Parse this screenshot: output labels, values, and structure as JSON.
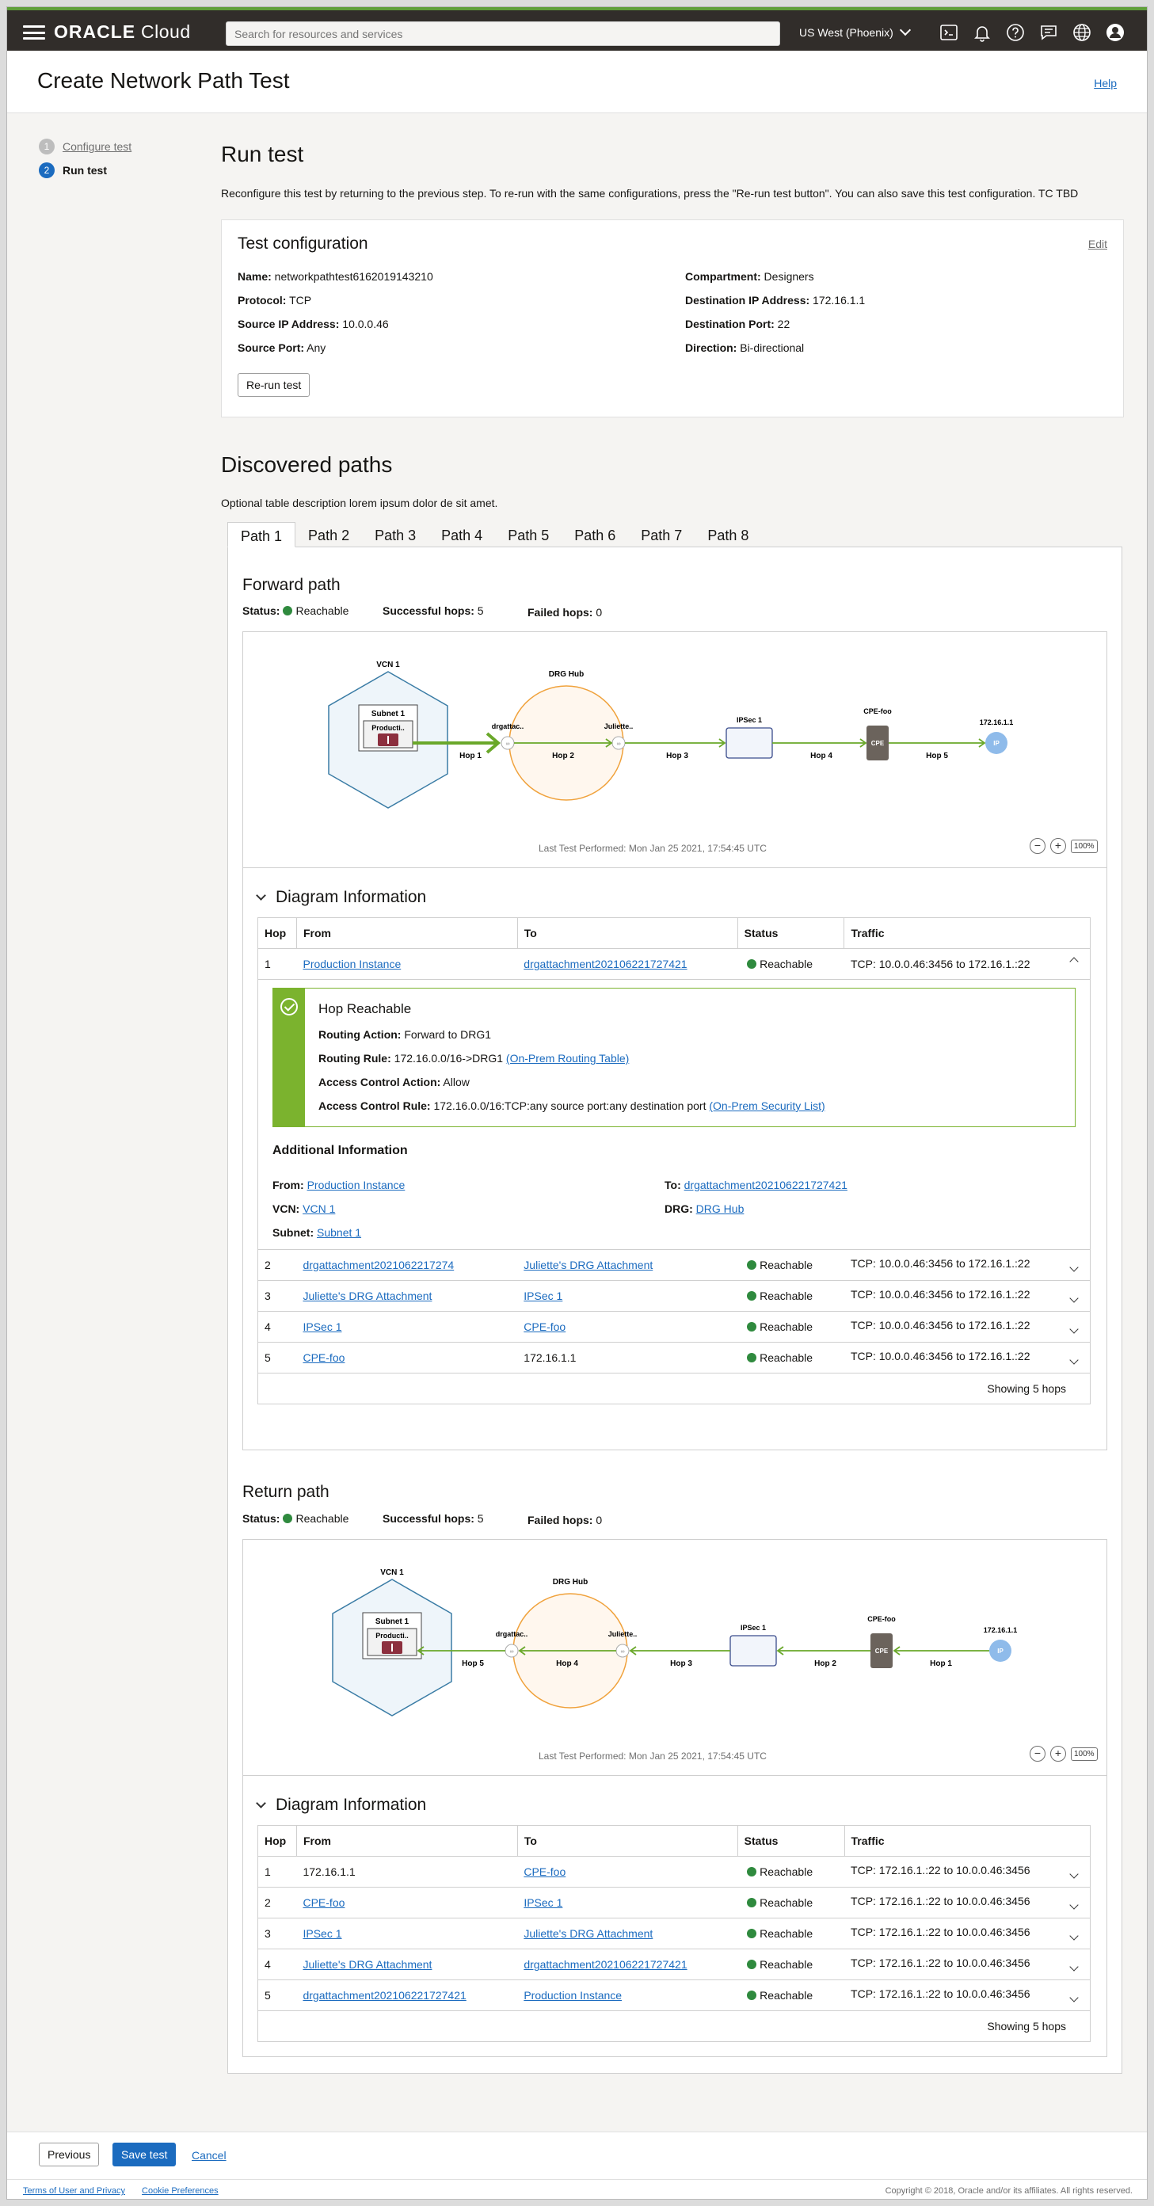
{
  "topbar": {
    "brand_bold": "ORACLE",
    "brand_light": " Cloud",
    "search_placeholder": "Search for resources and services",
    "region": "US West (Phoenix)"
  },
  "header": {
    "title": "Create Network Path Test",
    "help": "Help"
  },
  "steps": [
    {
      "num": "1",
      "label": "Configure test"
    },
    {
      "num": "2",
      "label": "Run test"
    }
  ],
  "run": {
    "title": "Run test",
    "description": "Reconfigure this test by returning to the previous step. To re-run with the same configurations, press the \"Re-run test button\". You can also save this test configuration. TC TBD"
  },
  "config": {
    "title": "Test configuration",
    "edit": "Edit",
    "left": [
      {
        "k": "Name:",
        "v": " networkpathtest6162019143210"
      },
      {
        "k": "Protocol:",
        "v": " TCP"
      },
      {
        "k": "Source IP Address:",
        "v": " 10.0.0.46"
      },
      {
        "k": "Source Port:",
        "v": " Any"
      }
    ],
    "right": [
      {
        "k": "Compartment:",
        "v": " Designers"
      },
      {
        "k": "Destination IP Address:",
        "v": " 172.16.1.1"
      },
      {
        "k": "Destination Port:",
        "v": " 22"
      },
      {
        "k": "Direction:",
        "v": " Bi-directional"
      }
    ],
    "rerun": "Re-run test"
  },
  "discovered": {
    "title": "Discovered paths",
    "description": "Optional table description lorem ipsum dolor de sit amet.",
    "tabs": [
      "Path 1",
      "Path 2",
      "Path 3",
      "Path 4",
      "Path 5",
      "Path 6",
      "Path 7",
      "Path 8"
    ]
  },
  "labels": {
    "status": "Status:",
    "reachable": "Reachable",
    "successful_hops": "Successful hops:",
    "failed_hops": "Failed hops:",
    "diagram_info": "Diagram Information",
    "last_test": "Last Test Performed: Mon Jan 25 2021, 17:54:45 UTC",
    "zoom": "100%",
    "showing": "Showing 5 hops",
    "col_hop": "Hop",
    "col_from": "From",
    "col_to": "To",
    "col_status": "Status",
    "col_traffic": "Traffic"
  },
  "diagram_labels": {
    "vcn": "VCN 1",
    "subnet": "Subnet 1",
    "instance": "Producti..",
    "drg_hub": "DRG Hub",
    "drg_attach": "drgattac..",
    "juliette": "Juliette..",
    "ipsec": "IPSec 1",
    "cpe_foo": "CPE-foo",
    "cpe": "CPE",
    "ip_addr": "172.16.1.1",
    "ip": "IP"
  },
  "forward": {
    "title": "Forward path",
    "successful": " 5",
    "failed": " 0",
    "hop_labels": [
      "Hop 1",
      "Hop 2",
      "Hop 3",
      "Hop 4",
      "Hop 5"
    ],
    "rows": [
      {
        "hop": "1",
        "from": "Production Instance",
        "to": "drgattachment20210622172742​1",
        "status": "Reachable",
        "traffic": "TCP: 10.0.0.46:3456 to 172.16.1.:22"
      },
      {
        "hop": "2",
        "from": "drgattachment2021062217274",
        "to": "Juliette's DRG Attachment ",
        "status": "Reachable",
        "traffic": "TCP: 10.0.0.46:3456 to 172.16.1.:22"
      },
      {
        "hop": "3",
        "from": "Juliette's DRG Attachment ",
        "to": "IPSec 1",
        "status": "Reachable",
        "traffic": "TCP: 10.0.0.46:3456 to 172.16.1.:22"
      },
      {
        "hop": "4",
        "from": "IPSec 1",
        "to": "CPE-foo",
        "status": "Reachable",
        "traffic": "TCP: 10.0.0.46:3456 to 172.16.1.:22"
      },
      {
        "hop": "5",
        "from": "CPE-foo",
        "to": "172.16.1.1",
        "status": "Reachable",
        "traffic": "TCP: 10.0.0.46:3456 to 172.16.1.:22"
      }
    ],
    "detail": {
      "title": "Hop Reachable",
      "routing_action_k": "Routing Action:",
      "routing_action_v": " Forward to DRG1",
      "routing_rule_k": "Routing Rule:",
      "routing_rule_v": " 172.16.0.0/16->DRG1 ",
      "routing_rule_link": "(On-Prem Routing Table)",
      "ac_action_k": "Access Control Action:",
      "ac_action_v": " Allow",
      "ac_rule_k": "Access Control Rule:",
      "ac_rule_v": " 172.16.0.0/16:TCP:any source port:any destination port ",
      "ac_rule_link": "(On-Prem Security List)",
      "addl_title": "Additional Information",
      "from_k": "From:",
      "from_v": "Production Instance",
      "to_k": "To:",
      "to_v": "drgattachment202106221727421",
      "vcn_k": "VCN:",
      "vcn_v": "VCN 1",
      "drg_k": "DRG:",
      "drg_v": "DRG Hub",
      "subnet_k": "Subnet:",
      "subnet_v": "Subnet 1"
    }
  },
  "return": {
    "title": "Return path",
    "successful": " 5",
    "failed": " 0",
    "hop_labels": [
      "Hop 5",
      "Hop 4",
      "Hop 3",
      "Hop 2",
      "Hop 1"
    ],
    "rows": [
      {
        "hop": "1",
        "from": "172.16.1.1",
        "to": "CPE-foo",
        "status": "Reachable",
        "traffic": "TCP: 172.16.1.:22 to 10.0.0.46:3456"
      },
      {
        "hop": "2",
        "from": "CPE-foo",
        "to": "IPSec 1",
        "status": "Reachable",
        "traffic": "TCP: 172.16.1.:22 to 10.0.0.46:3456"
      },
      {
        "hop": "3",
        "from": "IPSec 1",
        "to": "Juliette's DRG Attachment ",
        "status": "Reachable",
        "traffic": "TCP: 172.16.1.:22 to 10.0.0.46:3456"
      },
      {
        "hop": "4",
        "from": "Juliette's DRG Attachment ",
        "to": "drgattachment202106221727421",
        "status": "Reachable",
        "traffic": "TCP: 172.16.1.:22 to 10.0.0.46:3456"
      },
      {
        "hop": "5",
        "from": "drgattachment202106221727421",
        "to": "Production Instance",
        "status": "Reachable",
        "traffic": "TCP: 172.16.1.:22 to 10.0.0.46:3456"
      }
    ]
  },
  "actions": {
    "previous": "Previous",
    "save": "Save test",
    "cancel": "Cancel"
  },
  "footer": {
    "terms": "Terms of User and Privacy",
    "cookies": "Cookie Preferences",
    "copyright": "Copyright © 2018, Oracle and/or its affiliates. All rights reserved."
  },
  "colors": {
    "accent": "#1b6bbf",
    "reachable": "#2f8a3e",
    "path_green": "#6aa82a",
    "topbar": "#312d2a"
  }
}
